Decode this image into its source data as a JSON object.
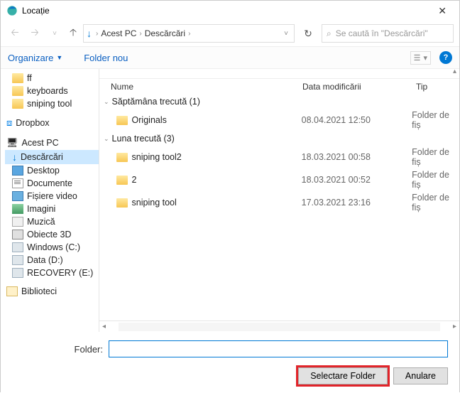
{
  "titlebar": {
    "title": "Locație"
  },
  "breadcrumb": {
    "root": "Acest PC",
    "current": "Descărcări"
  },
  "search": {
    "placeholder": "Se caută în \"Descărcări\""
  },
  "toolbar": {
    "organize": "Organizare",
    "newfolder": "Folder nou"
  },
  "tree": {
    "ff": "ff",
    "keyboards": "keyboards",
    "sniping": "sniping tool",
    "dropbox": "Dropbox",
    "thispc": "Acest PC",
    "downloads": "Descărcări",
    "desktop": "Desktop",
    "documents": "Documente",
    "videos": "Fișiere video",
    "pictures": "Imagini",
    "music": "Muzică",
    "objects": "Obiecte 3D",
    "windows": "Windows (C:)",
    "data": "Data (D:)",
    "recovery": "RECOVERY (E:)",
    "libraries": "Biblioteci"
  },
  "columns": {
    "name": "Nume",
    "date": "Data modificării",
    "type": "Tip"
  },
  "groups": {
    "lastweek": "Săptămâna trecută (1)",
    "lastmonth": "Luna trecută (3)"
  },
  "rows": {
    "r1": {
      "name": "Originals",
      "date": "08.04.2021 12:50",
      "type": "Folder de fiș"
    },
    "r2": {
      "name": "sniping tool2",
      "date": "18.03.2021 00:58",
      "type": "Folder de fiș"
    },
    "r3": {
      "name": "2",
      "date": "18.03.2021 00:52",
      "type": "Folder de fiș"
    },
    "r4": {
      "name": "sniping tool",
      "date": "17.03.2021 23:16",
      "type": "Folder de fiș"
    }
  },
  "bottom": {
    "label": "Folder:",
    "select": "Selectare Folder",
    "cancel": "Anulare"
  }
}
